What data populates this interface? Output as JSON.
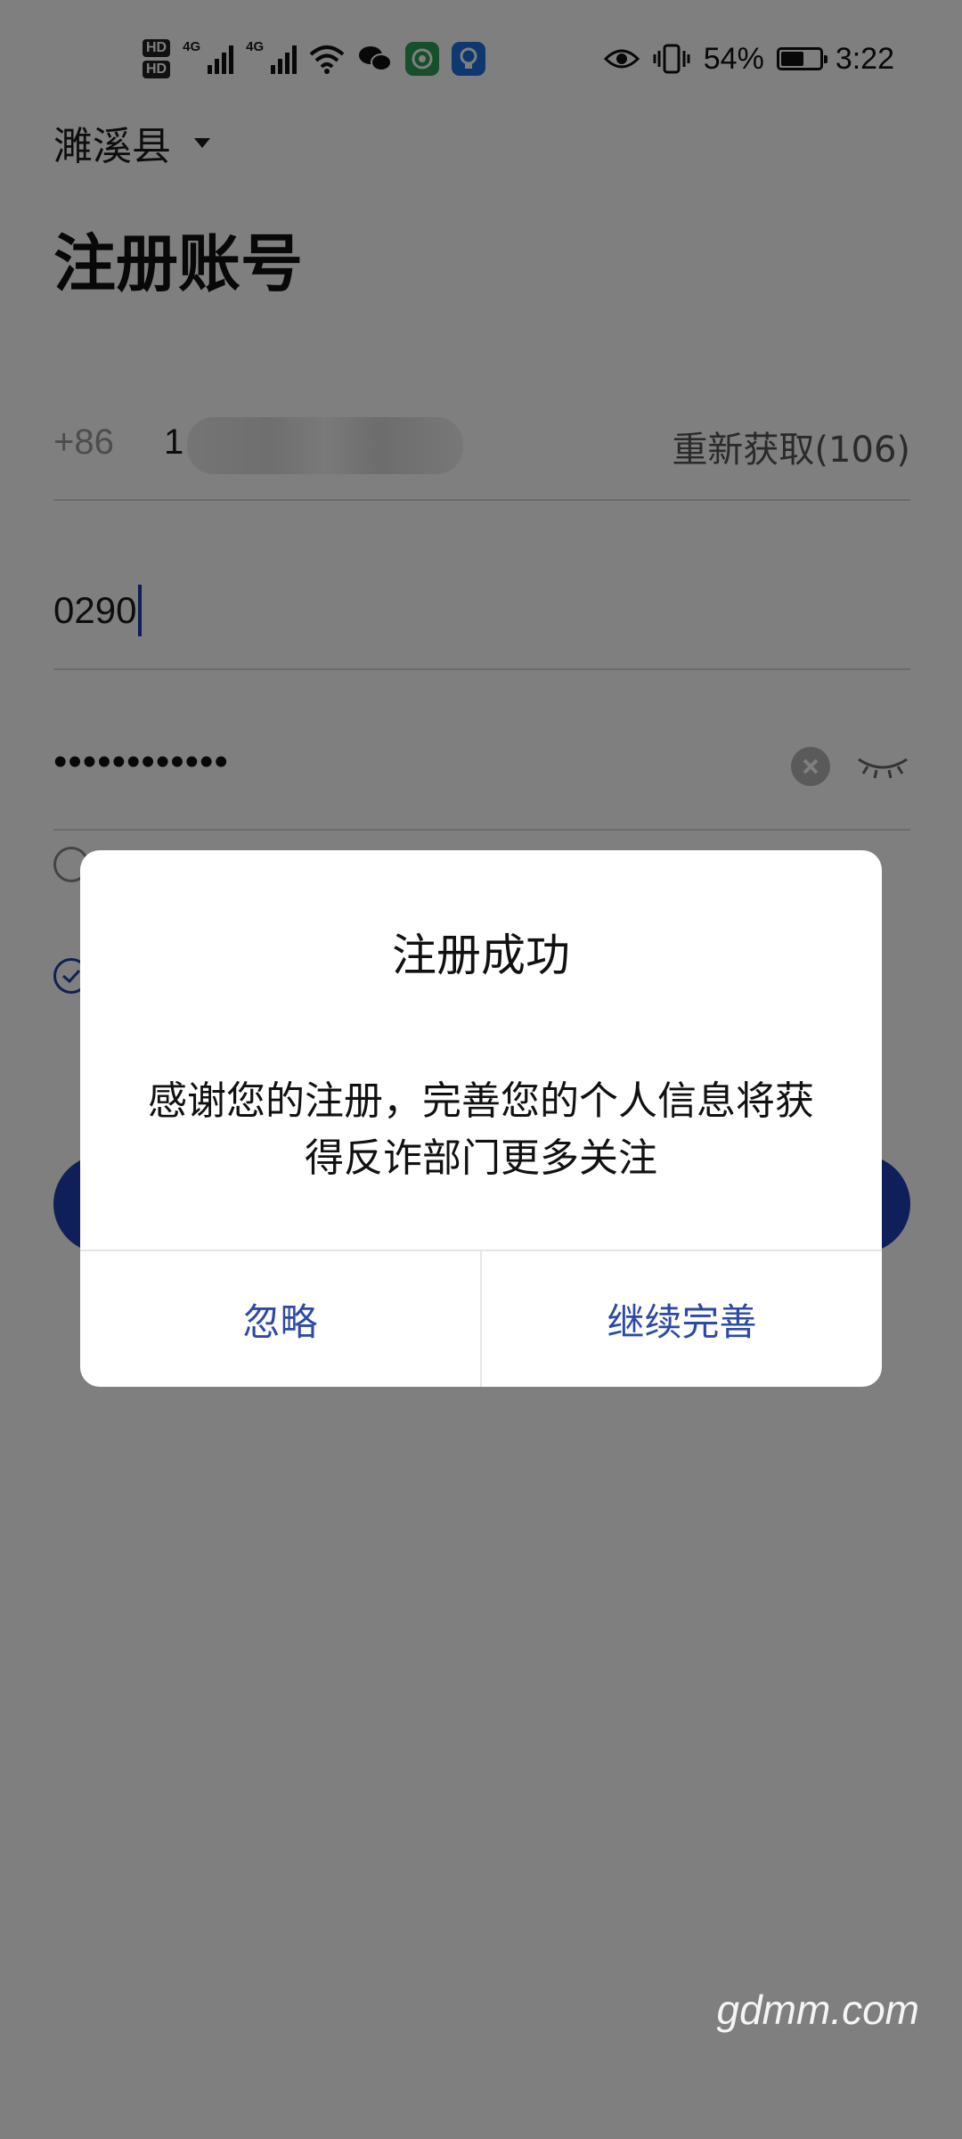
{
  "status_bar": {
    "hd_label_1": "HD",
    "hd_label_2": "HD",
    "net_label_1": "4G",
    "net_label_2": "4G",
    "battery": "54%",
    "battery_fill": 0.54,
    "time": "3:22"
  },
  "page": {
    "region": "濉溪县",
    "title": "注册账号",
    "country_code": "+86",
    "phone_prefix": "1",
    "resend": "重新获取(106)",
    "verification_code": "0290",
    "password_mask": "••••••••••••"
  },
  "dialog": {
    "title": "注册成功",
    "message": "感谢您的注册，完善您的个人信息将获得反诈部门更多关注",
    "ignore": "忽略",
    "continue": "继续完善"
  },
  "watermark": "gdmm.com",
  "colors": {
    "accent": "#1e3fb3",
    "dialog_button_text": "#2c4aa6",
    "overlay": "rgba(0,0,0,0.5)"
  }
}
